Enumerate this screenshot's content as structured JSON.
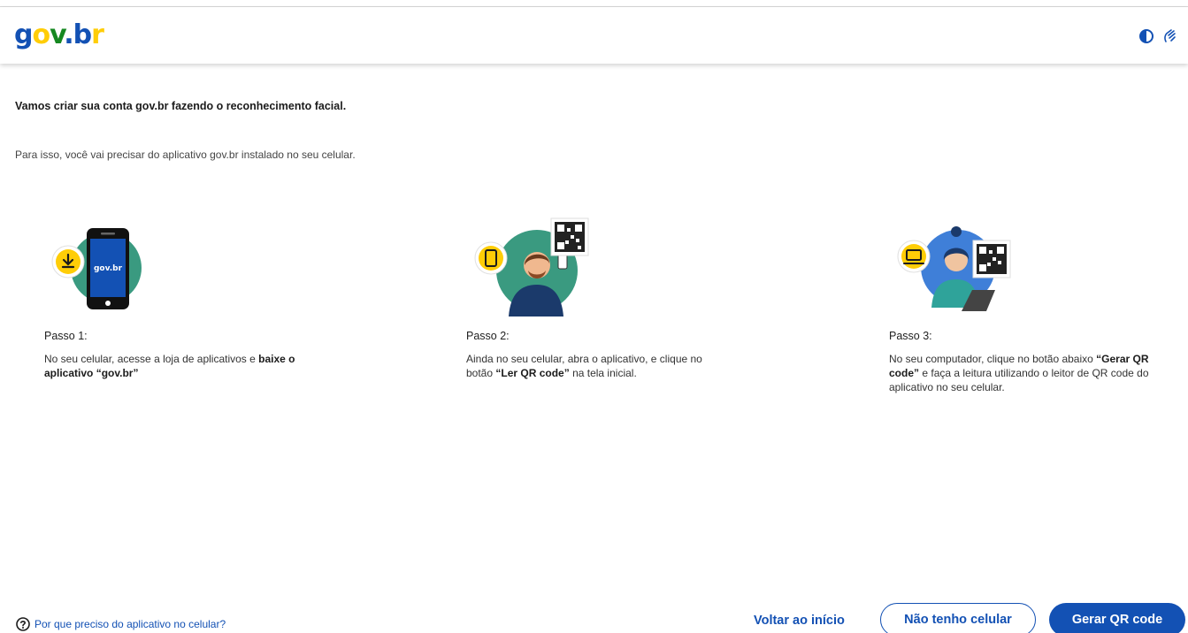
{
  "header": {
    "logo": {
      "g": "g",
      "o": "o",
      "v": "v",
      "dot": ".",
      "b": "b",
      "r": "r"
    },
    "contrast_icon": "contrast-icon",
    "libras_icon": "sign-language-icon"
  },
  "intro": {
    "title": "Vamos criar sua conta gov.br fazendo o reconhecimento facial.",
    "text": "Para isso, você vai precisar do aplicativo gov.br instalado no seu celular."
  },
  "steps": [
    {
      "title": "Passo 1:",
      "text_before": "No seu celular, acesse a loja de aplicativos e ",
      "text_bold": "baixe o aplicativo “gov.br”",
      "text_after": "",
      "phone_logo": "gov.br"
    },
    {
      "title": "Passo 2:",
      "text_before": "Ainda no seu celular, abra o aplicativo, e clique no botão ",
      "text_bold": "“Ler QR code”",
      "text_after": " na tela inicial."
    },
    {
      "title": "Passo 3:",
      "text_before": "No seu computador, clique no botão abaixo ",
      "text_bold": "“Gerar QR code”",
      "text_after": " e faça a leitura utilizando o leitor de QR code do aplicativo no seu celular."
    }
  ],
  "footer": {
    "help_link": "Por que preciso do aplicativo no celular?",
    "back_button": "Voltar ao início",
    "no_phone_button": "Não tenho celular",
    "generate_qr_button": "Gerar QR code"
  },
  "colors": {
    "primary": "#1351b4",
    "accent_yellow": "#ffcd07",
    "accent_green": "#168821",
    "illustration_teal": "#3a9a80"
  }
}
